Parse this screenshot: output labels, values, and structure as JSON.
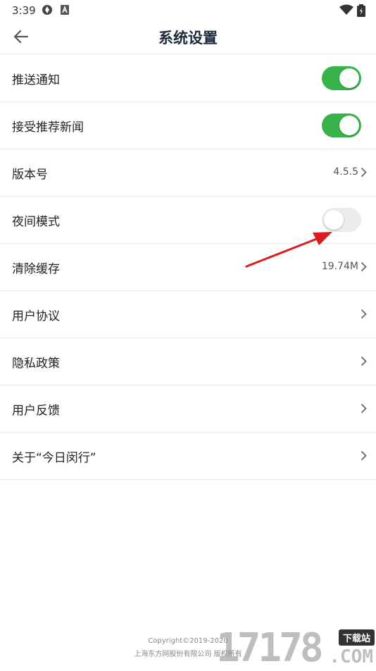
{
  "status_bar": {
    "time": "3:39",
    "icons": [
      "sync-app-icon",
      "a-app-icon",
      "wifi-icon",
      "battery-charging-icon"
    ]
  },
  "header": {
    "title": "系统设置",
    "back_icon": "arrow-left-icon"
  },
  "settings": {
    "push_notify": {
      "label": "推送通知",
      "toggle_on": true
    },
    "recommended_news": {
      "label": "接受推荐新闻",
      "toggle_on": true
    },
    "version": {
      "label": "版本号",
      "value": "4.5.5"
    },
    "night_mode": {
      "label": "夜间模式",
      "toggle_on": false
    },
    "clear_cache": {
      "label": "清除缓存",
      "value": "19.74M"
    },
    "user_agreement": {
      "label": "用户协议"
    },
    "privacy_policy": {
      "label": "隐私政策"
    },
    "user_feedback": {
      "label": "用户反馈"
    },
    "about": {
      "label": "关于“今日闵行”"
    }
  },
  "footer": {
    "copyright": "Copyright©2019-2020",
    "company": "上海东方网股份有限公司 版权所有"
  },
  "watermark": {
    "digits": "17178",
    "badge": "下载站",
    "suffix": ".COM"
  },
  "colors": {
    "toggle_on": "#38b24a",
    "toggle_off": "#ebebeb",
    "annotation_arrow": "#d81e1e",
    "title": "#1c2a3a"
  }
}
